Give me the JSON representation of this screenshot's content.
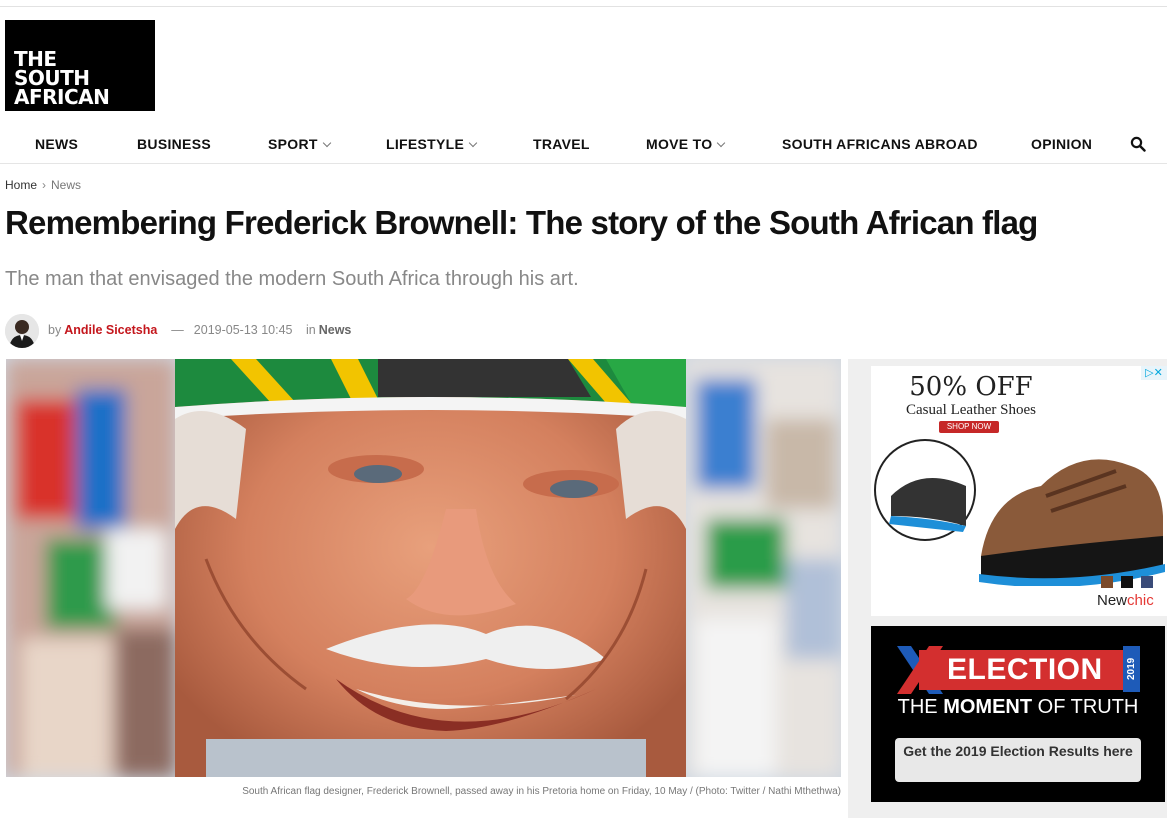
{
  "brand": {
    "logo_lines": [
      "THE",
      "SOUTH",
      "AFRICAN"
    ]
  },
  "nav": {
    "items": [
      {
        "label": "NEWS",
        "dropdown": false
      },
      {
        "label": "BUSINESS",
        "dropdown": false
      },
      {
        "label": "SPORT",
        "dropdown": true
      },
      {
        "label": "LIFESTYLE",
        "dropdown": true
      },
      {
        "label": "TRAVEL",
        "dropdown": false
      },
      {
        "label": "MOVE TO",
        "dropdown": true
      },
      {
        "label": "SOUTH AFRICANS ABROAD",
        "dropdown": false
      },
      {
        "label": "OPINION",
        "dropdown": false
      }
    ],
    "search_icon": "search-icon"
  },
  "breadcrumb": {
    "home": "Home",
    "section": "News"
  },
  "article": {
    "title": "Remembering Frederick Brownell: The story of the South African flag",
    "subtitle": "The man that envisaged the modern South Africa through his art.",
    "by": "by",
    "author": "Andile Sicetsha",
    "dash": "—",
    "date": "2019-05-13 10:45",
    "in": "in",
    "category": "News",
    "caption": "South African flag designer, Frederick Brownell, passed away in his Pretoria home on Friday, 10 May / (Photo: Twitter / Nathi Mthethwa)"
  },
  "ads": {
    "shoe": {
      "headline": "50% OFF",
      "sub": "Casual Leather Shoes",
      "cta": "SHOP NOW",
      "brand_a": "New",
      "brand_b": "chic",
      "choices": "▷✕"
    },
    "election": {
      "word": "ELECTION",
      "year": "2019",
      "tag_a": "THE ",
      "tag_b": "MOMENT",
      "tag_c": " OF TRUTH",
      "button": "Get the 2019 Election Results here"
    }
  },
  "colors": {
    "accent": "#c4161c",
    "election_red": "#d32f2f",
    "election_blue": "#1e5bb8"
  }
}
